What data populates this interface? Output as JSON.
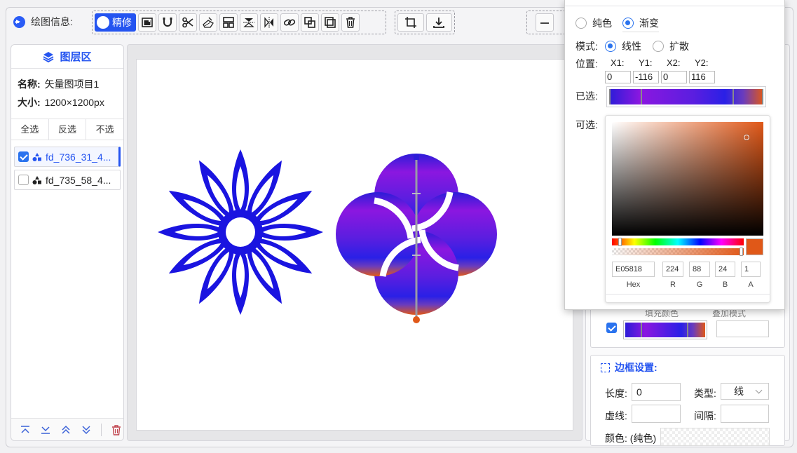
{
  "toolbar": {
    "label": "绘图信息:",
    "refine_label": "精修"
  },
  "layer_panel": {
    "title": "图层区",
    "name_label": "名称:",
    "name_value": "矢量图项目1",
    "size_label": "大小:",
    "size_value": "1200×1200px",
    "select_all": "全选",
    "invert_select": "反选",
    "select_none": "不选",
    "layers": [
      {
        "label": "fd_736_31_4...",
        "checked": true
      },
      {
        "label": "fd_735_58_4...",
        "checked": false
      }
    ]
  },
  "gradient_popup": {
    "solid_label": "纯色",
    "gradient_label": "渐变",
    "mode_label": "模式:",
    "linear_label": "线性",
    "diffuse_label": "扩散",
    "position_label": "位置:",
    "x1_label": "X1:",
    "y1_label": "Y1:",
    "x2_label": "X2:",
    "y2_label": "Y2:",
    "x1_value": "0",
    "y1_value": "-116",
    "x2_value": "0",
    "y2_value": "116",
    "selected_label": "已选:",
    "optional_label": "可选:"
  },
  "color_picker": {
    "hex_value": "E05818",
    "r_value": "224",
    "g_value": "88",
    "b_value": "24",
    "a_value": "1",
    "hex_label": "Hex",
    "r_label": "R",
    "g_label": "G",
    "b_label": "B",
    "a_label": "A",
    "current_color": "#e05818"
  },
  "fill_section": {
    "fill_color_label": "填充颜色",
    "blend_mode_label": "叠加模式"
  },
  "border_section": {
    "title": "边框设置:",
    "length_label": "长度:",
    "length_value": "0",
    "type_label": "类型:",
    "type_value": "线",
    "dash_label": "虚线:",
    "gap_label": "间隔:",
    "color_label": "颜色: (纯色)"
  },
  "colors": {
    "accent": "#2454f0",
    "flower_blue": "#1a14e0",
    "gradient_top": "#2c1cd8",
    "gradient_mid": "#8b17e0",
    "gradient_end": "#e05818"
  }
}
